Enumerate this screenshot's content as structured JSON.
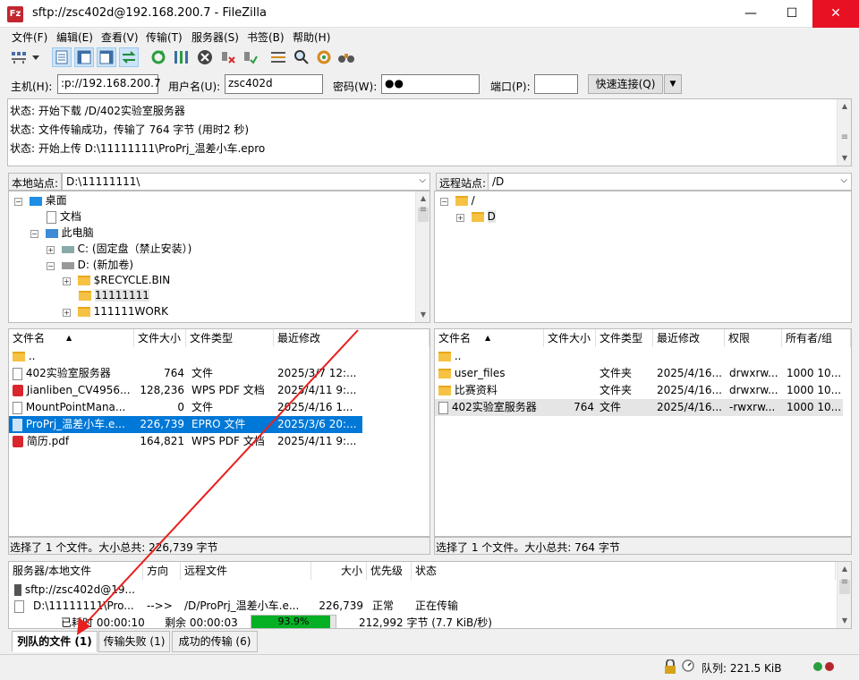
{
  "window": {
    "title": "sftp://zsc402d@192.168.200.7 - FileZilla",
    "app_icon": "Fz",
    "minimize": "—",
    "maximize": "☐",
    "close": "✕"
  },
  "menu": [
    "文件(F)",
    "编辑(E)",
    "查看(V)",
    "传输(T)",
    "服务器(S)",
    "书签(B)",
    "帮助(H)"
  ],
  "quickconnect": {
    "host_label": "主机(H):",
    "host_value": ":p://192.168.200.7",
    "user_label": "用户名(U):",
    "user_value": "zsc402d",
    "pass_label": "密码(W):",
    "pass_value": "●●",
    "port_label": "端口(P):",
    "port_value": "",
    "connect_button": "快速连接(Q)",
    "dropdown": "▼"
  },
  "log": [
    "状态: 开始下载 /D/402实验室服务器",
    "状态: 文件传输成功，传输了 764 字节 (用时2 秒)",
    "状态: 开始上传 D:\\11111111\\ProPrj_温差小车.epro"
  ],
  "local": {
    "site_label": "本地站点:",
    "path": "D:\\11111111\\",
    "tree": [
      {
        "label": "桌面",
        "icon": "desktop-icon",
        "expander": "⊟"
      },
      {
        "label": "文档",
        "icon": "document-icon",
        "expander": ""
      },
      {
        "label": "此电脑",
        "icon": "computer-icon",
        "expander": "⊟"
      },
      {
        "label": "C: (固定盘（禁止安装）)",
        "icon": "drive-icon",
        "expander": "⊞"
      },
      {
        "label": "D: (新加卷)",
        "icon": "drive-icon",
        "expander": "⊟"
      },
      {
        "label": "$RECYCLE.BIN",
        "icon": "folder-icon",
        "expander": "⊞"
      },
      {
        "label": "11111111",
        "icon": "folder-icon",
        "expander": ""
      },
      {
        "label": "111111WORK",
        "icon": "folder-icon",
        "expander": "⊞"
      }
    ],
    "columns": [
      "文件名",
      "文件大小",
      "文件类型",
      "最近修改"
    ],
    "files": [
      {
        "name": "..",
        "size": "",
        "type": "",
        "modified": "",
        "icon": "folder"
      },
      {
        "name": "402实验室服务器",
        "size": "764",
        "type": "文件",
        "modified": "2025/3/7 12:...",
        "icon": "file"
      },
      {
        "name": "Jianliben_CV4956...",
        "size": "128,236",
        "type": "WPS PDF 文档",
        "modified": "2025/4/11 9:...",
        "icon": "pdf"
      },
      {
        "name": "MountPointMana...",
        "size": "0",
        "type": "文件",
        "modified": "2025/4/16 1...",
        "icon": "file"
      },
      {
        "name": "ProPrj_温差小车.e...",
        "size": "226,739",
        "type": "EPRO 文件",
        "modified": "2025/3/6 20:...",
        "icon": "file"
      },
      {
        "name": "简历.pdf",
        "size": "164,821",
        "type": "WPS PDF 文档",
        "modified": "2025/4/11 9:...",
        "icon": "pdf"
      }
    ],
    "status": "选择了 1 个文件。大小总共: 226,739 字节"
  },
  "remote": {
    "site_label": "远程站点:",
    "path": "/D",
    "tree": [
      {
        "label": "/",
        "expander": "⊟"
      },
      {
        "label": "D",
        "expander": "⊞"
      }
    ],
    "columns": [
      "文件名",
      "文件大小",
      "文件类型",
      "最近修改",
      "权限",
      "所有者/组"
    ],
    "files": [
      {
        "name": "..",
        "size": "",
        "type": "",
        "modified": "",
        "perm": "",
        "owner": "",
        "icon": "folder"
      },
      {
        "name": "user_files",
        "size": "",
        "type": "文件夹",
        "modified": "2025/4/16...",
        "perm": "drwxrw...",
        "owner": "1000 10...",
        "icon": "folder"
      },
      {
        "name": "比赛资料",
        "size": "",
        "type": "文件夹",
        "modified": "2025/4/16...",
        "perm": "drwxrw...",
        "owner": "1000 10...",
        "icon": "folder"
      },
      {
        "name": "402实验室服务器",
        "size": "764",
        "type": "文件",
        "modified": "2025/4/16...",
        "perm": "-rwxrw...",
        "owner": "1000 10...",
        "icon": "file"
      }
    ],
    "status": "选择了 1 个文件。大小总共: 764 字节"
  },
  "queue": {
    "columns": [
      "服务器/本地文件",
      "方向",
      "远程文件",
      "大小",
      "优先级",
      "状态"
    ],
    "server": "sftp://zsc402d@19...",
    "item": {
      "local": "D:\\11111111\\Pro...",
      "direction": "-->>",
      "remote": "/D/ProPrj_温差小车.e...",
      "size": "226,739",
      "priority": "正常",
      "status": "正在传输"
    },
    "elapsed": "已耗时 00:00:10",
    "remaining": "剩余 00:00:03",
    "progress_text": "93.9%",
    "progress": 0.939,
    "bytes": "212,992 字节 (7.7 KiB/秒)"
  },
  "tabs": [
    "列队的文件 (1)",
    "传输失败 (1)",
    "成功的传输 (6)"
  ],
  "statusbar": {
    "queue": "队列: 221.5 KiB"
  }
}
